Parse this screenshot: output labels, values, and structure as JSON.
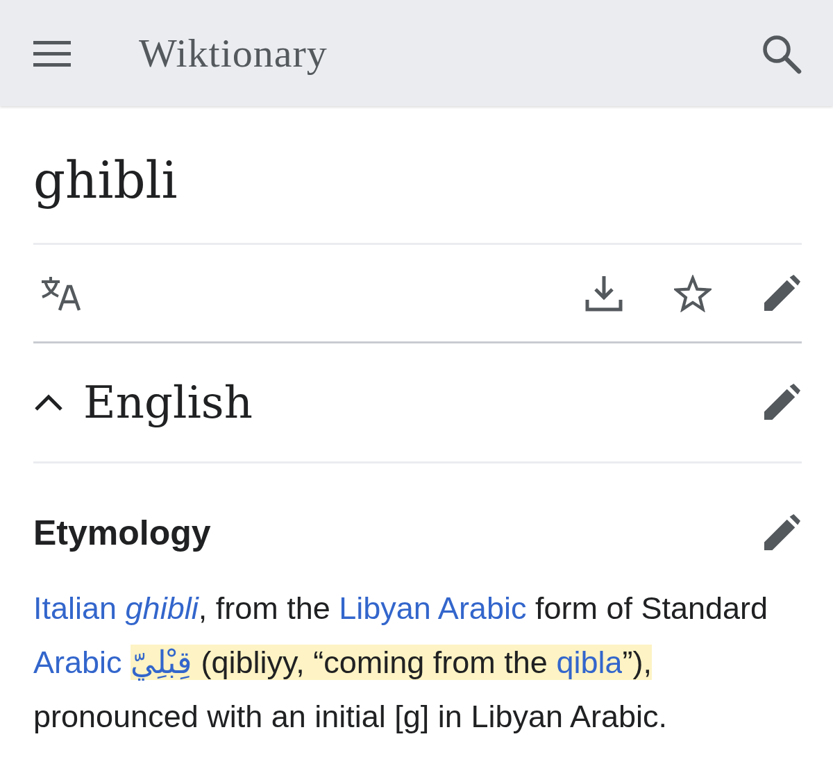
{
  "header": {
    "site_title": "Wiktionary"
  },
  "page_title": "ghibli",
  "section": {
    "title": "English",
    "expanded": true
  },
  "subsection": {
    "title": "Etymology"
  },
  "paragraph": [
    {
      "kind": "link",
      "text": "Italian ",
      "italic": false,
      "highlighted": false
    },
    {
      "kind": "link",
      "text": "ghibli",
      "italic": true,
      "highlighted": false
    },
    {
      "kind": "text",
      "text": ", from the ",
      "italic": false,
      "highlighted": false
    },
    {
      "kind": "link",
      "text": "Libyan Arabic",
      "italic": false,
      "highlighted": false
    },
    {
      "kind": "text",
      "text": " form of Standard ",
      "italic": false,
      "highlighted": false
    },
    {
      "kind": "link",
      "text": "Arabic ",
      "italic": false,
      "highlighted": false
    },
    {
      "kind": "link",
      "text": "قِبْلِيّ",
      "italic": false,
      "highlighted": true
    },
    {
      "kind": "text",
      "text": " (qibliyy, “coming from the ",
      "italic": false,
      "highlighted": true
    },
    {
      "kind": "link",
      "text": "qibla",
      "italic": false,
      "highlighted": true
    },
    {
      "kind": "text",
      "text": "”),",
      "italic": false,
      "highlighted": true
    },
    {
      "kind": "text",
      "text": " pronounced with an initial [g] in Libyan Arabic.",
      "italic": false,
      "highlighted": false
    }
  ]
}
